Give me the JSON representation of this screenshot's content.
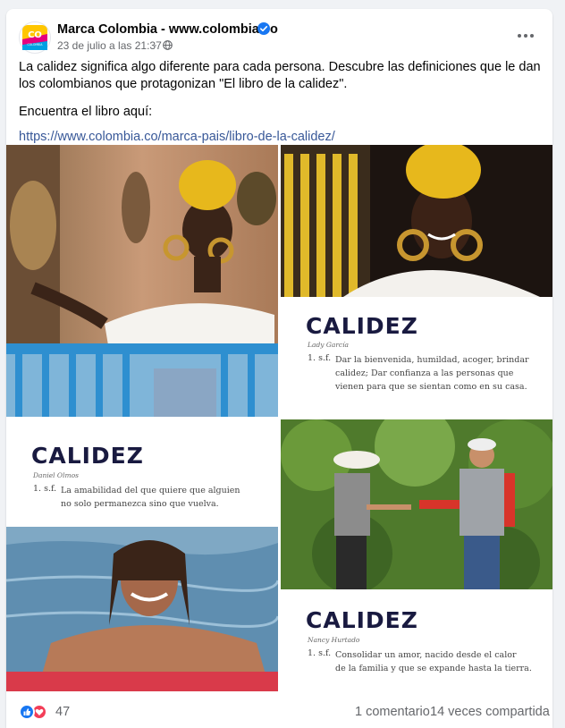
{
  "post": {
    "page_name": "Marca Colombia - www.colombia.co",
    "timestamp": "23 de julio a las 21:37",
    "separator": "·",
    "text": "La calidez significa algo diferente para cada persona. Descubre las definiciones que le dan los colombianos que protagonizan \"El libro de la calidez\".",
    "cta": "Encuentra el libro aquí:",
    "link": "https://www.colombia.co/marca-pais/libro-de-la-calidez/"
  },
  "avatar": {
    "logo_text": "CO",
    "logo_sub": "COLOMBIA"
  },
  "photos": [
    {
      "title": "CALIDEZ",
      "person": "Lady García",
      "number": "1.  s.f.",
      "lines": [
        "Dar la bienvenida, humildad, acoger, brindar",
        "calidez; Dar confianza a las personas que",
        "vienen para que se sientan como en su casa."
      ]
    },
    {
      "title": "CALIDEZ",
      "person": "Daniel Olmos",
      "number": "1.  s.f.",
      "lines": [
        "La amabilidad del que quiere que alguien",
        "no solo permanezca sino que vuelva."
      ]
    },
    {
      "title": "CALIDEZ",
      "person": "Nancy Hurtado",
      "number": "1.  s.f.",
      "lines": [
        "Consolidar un amor, nacido desde el calor",
        "de la familia y que se expande hasta la tierra."
      ]
    }
  ],
  "footer": {
    "reaction_count": "47",
    "comments": "1 comentario",
    "shares": "14 veces compartida"
  },
  "colors": {
    "link": "#385898",
    "verified": "#1877f2",
    "like": "#1877f2",
    "love": "#f33e58",
    "definition_title": "#191a40"
  },
  "icons": [
    "more-icon",
    "verified-icon",
    "globe-icon",
    "like-icon",
    "love-icon"
  ]
}
